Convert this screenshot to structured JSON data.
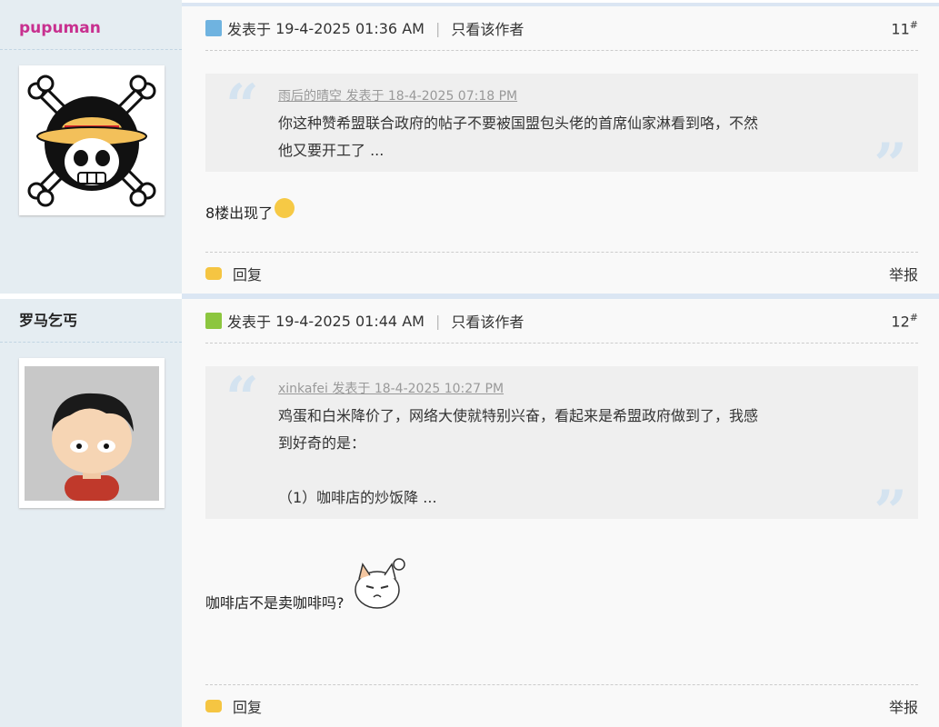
{
  "posts": [
    {
      "author": "pupuman",
      "posted_label": "发表于",
      "datetime": "19-4-2025 01:36 AM",
      "only_author": "只看该作者",
      "floor": "11",
      "floor_mark": "#",
      "quote_source": "雨后的晴空 发表于 18-4-2025 07:18 PM",
      "quote_lines": [
        "你这种赞希盟联合政府的帖子不要被国盟包头佬的首席仙家淋看到咯，不然",
        "他又要开工了 ..."
      ],
      "reply_text": "8楼出现了",
      "reply_label": "回复",
      "report_label": "举报",
      "post_icon_color": "#6fb3e0"
    },
    {
      "author": "罗马乞丐",
      "posted_label": "发表于",
      "datetime": "19-4-2025 01:44 AM",
      "only_author": "只看该作者",
      "floor": "12",
      "floor_mark": "#",
      "quote_source": "xinkafei 发表于 18-4-2025 10:27 PM",
      "quote_lines": [
        "鸡蛋和白米降价了，网络大使就特别兴奋，看起来是希盟政府做到了，我感",
        "到好奇的是：",
        "",
        "（1）咖啡店的炒饭降 ..."
      ],
      "reply_text": "咖啡店不是卖咖啡吗?",
      "reply_label": "回复",
      "report_label": "举报",
      "post_icon_color": "#8cc63f"
    }
  ]
}
